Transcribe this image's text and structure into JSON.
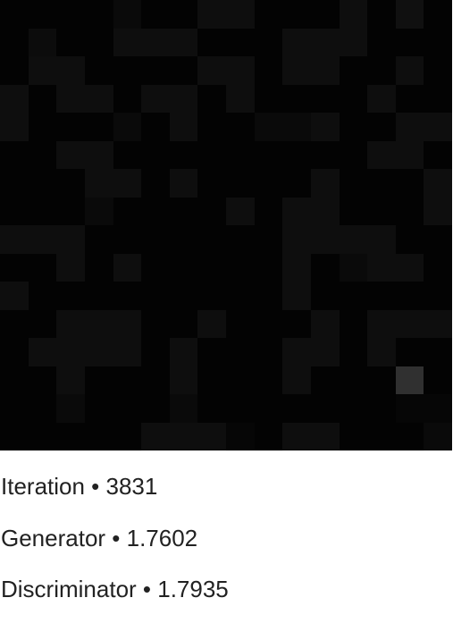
{
  "sample": {
    "rows": 16,
    "cols": 16,
    "cells": [
      [
        3,
        3,
        3,
        3,
        10,
        3,
        3,
        14,
        14,
        3,
        3,
        3,
        14,
        3,
        16,
        3
      ],
      [
        3,
        12,
        3,
        3,
        14,
        14,
        14,
        3,
        3,
        3,
        14,
        14,
        14,
        3,
        3,
        3
      ],
      [
        3,
        14,
        14,
        3,
        3,
        3,
        3,
        14,
        14,
        3,
        14,
        14,
        3,
        3,
        14,
        3
      ],
      [
        14,
        3,
        14,
        14,
        3,
        14,
        14,
        3,
        14,
        3,
        3,
        3,
        3,
        14,
        3,
        3
      ],
      [
        14,
        3,
        3,
        3,
        10,
        3,
        14,
        3,
        3,
        10,
        10,
        14,
        3,
        3,
        14,
        14
      ],
      [
        3,
        3,
        14,
        14,
        3,
        3,
        3,
        3,
        3,
        3,
        3,
        3,
        3,
        14,
        14,
        3
      ],
      [
        3,
        3,
        3,
        14,
        14,
        3,
        14,
        3,
        3,
        3,
        3,
        14,
        3,
        3,
        3,
        14
      ],
      [
        3,
        3,
        3,
        10,
        3,
        3,
        3,
        3,
        14,
        3,
        14,
        14,
        3,
        3,
        3,
        14
      ],
      [
        14,
        14,
        14,
        3,
        3,
        3,
        3,
        3,
        3,
        3,
        14,
        14,
        14,
        14,
        3,
        3
      ],
      [
        3,
        3,
        14,
        3,
        14,
        3,
        3,
        3,
        3,
        3,
        14,
        3,
        10,
        14,
        14,
        3
      ],
      [
        14,
        3,
        3,
        3,
        3,
        3,
        3,
        3,
        3,
        3,
        14,
        3,
        3,
        3,
        3,
        3
      ],
      [
        3,
        3,
        14,
        14,
        14,
        3,
        3,
        14,
        3,
        3,
        3,
        14,
        3,
        14,
        14,
        14
      ],
      [
        3,
        14,
        14,
        14,
        14,
        3,
        14,
        3,
        3,
        3,
        14,
        14,
        3,
        14,
        3,
        3
      ],
      [
        3,
        3,
        14,
        3,
        3,
        3,
        14,
        3,
        3,
        3,
        14,
        3,
        3,
        3,
        48,
        3
      ],
      [
        3,
        3,
        10,
        3,
        3,
        3,
        10,
        3,
        3,
        3,
        3,
        3,
        3,
        3,
        6,
        6
      ],
      [
        3,
        3,
        3,
        3,
        3,
        14,
        14,
        14,
        6,
        3,
        14,
        14,
        3,
        3,
        3,
        10
      ]
    ]
  },
  "stats": {
    "iteration": "Iteration • 3831",
    "generator": "Generator • 1.7602",
    "discriminator": "Discriminator • 1.7935"
  }
}
